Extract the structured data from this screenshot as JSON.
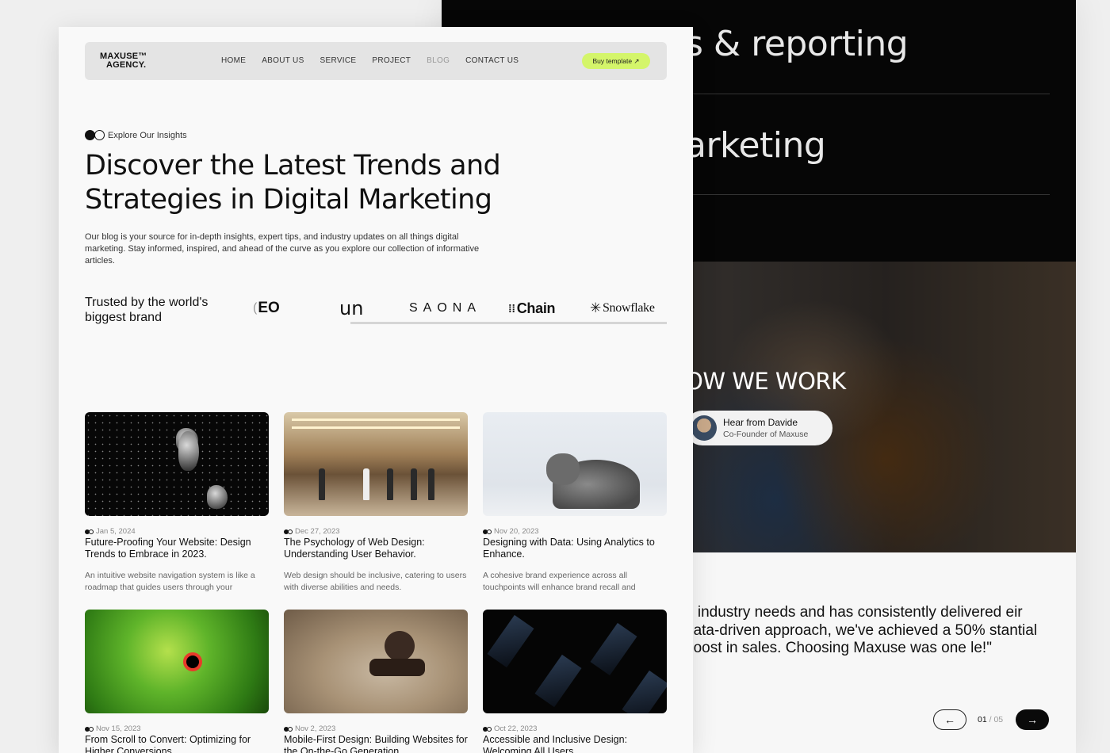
{
  "back_page": {
    "heading_1": "s & reporting",
    "heading_2": "arketing",
    "section_title": "OW WE WORK",
    "testimonial_pill": {
      "name": "Hear from Davide",
      "role": "Co-Founder of Maxuse"
    },
    "quote": "e industry needs and has consistently delivered eir data-driven approach, we've achieved a 50% stantial boost in sales. Choosing Maxuse was one le!\"",
    "pager": {
      "prev_icon": "←",
      "current": "01",
      "separator": " / ",
      "total": "05",
      "next_icon": "→"
    }
  },
  "navbar": {
    "logo_line1": "MAXUSE™",
    "logo_line2": "AGENCY.",
    "links": [
      "HOME",
      "ABOUT US",
      "SERVICE",
      "PROJECT",
      "BLOG",
      "CONTACT US"
    ],
    "active_link": "BLOG",
    "buy_button": "Buy template ↗",
    "accent_color": "#d4f56a"
  },
  "hero": {
    "eyebrow": "Explore Our Insights",
    "title": "Discover the Latest Trends and Strategies in Digital Marketing",
    "description": "Our blog is your source for in-depth insights, expert tips, and industry updates on all things digital marketing. Stay informed, inspired, and ahead of the curve as you explore our collection of informative articles."
  },
  "trusted": {
    "label": "Trusted by the world's biggest brand",
    "brands": [
      "EO",
      "un",
      "SAONA",
      "Chain",
      "Snowflake"
    ]
  },
  "posts": [
    {
      "date": "Jan 5, 2024",
      "title": "Future-Proofing Your Website: Design Trends to Embrace in 2023.",
      "excerpt": "An intuitive website navigation system is like a roadmap that guides users through your",
      "image": "asteroids-in-space"
    },
    {
      "date": "Dec 27, 2023",
      "title": "The Psychology of Web Design: Understanding User Behavior.",
      "excerpt": "Web design should be inclusive, catering to users with diverse abilities and needs.",
      "image": "people-walking-mall"
    },
    {
      "date": "Nov 20, 2023",
      "title": "Designing with Data: Using Analytics to Enhance.",
      "excerpt": "A cohesive brand experience across all touchpoints will enhance brand recall and",
      "image": "grey-cat-lying"
    },
    {
      "date": "Nov 15, 2023",
      "title": "From Scroll to Convert: Optimizing for Higher Conversions",
      "excerpt": "",
      "image": "green-parrot"
    },
    {
      "date": "Nov 2, 2023",
      "title": "Mobile-First Design: Building Websites for the On-the-Go Generation",
      "excerpt": "",
      "image": "atv-rider-dust"
    },
    {
      "date": "Oct 22, 2023",
      "title": "Accessible and Inclusive Design: Welcoming All Users",
      "excerpt": "",
      "image": "dark-abstract-shapes"
    }
  ]
}
